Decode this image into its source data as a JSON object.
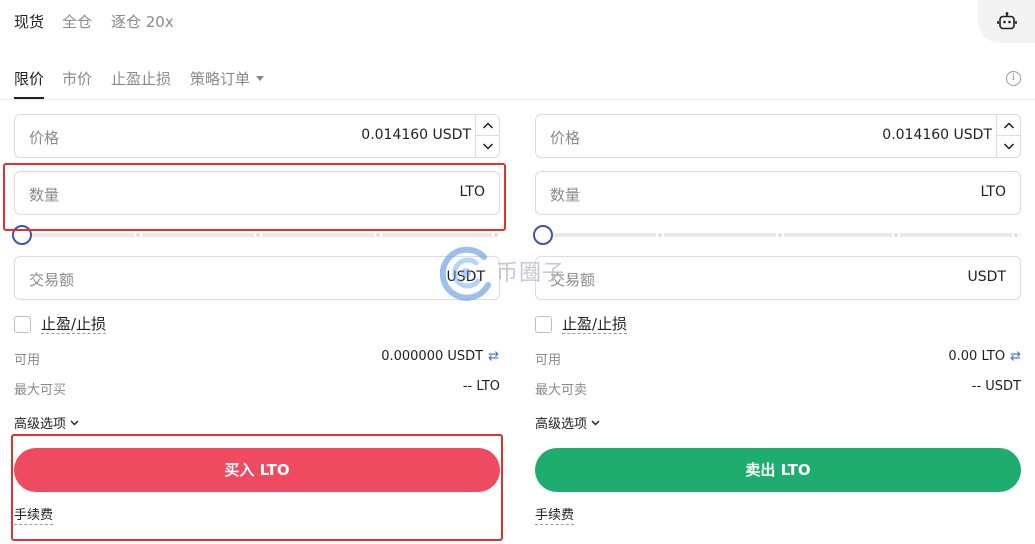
{
  "mode_tabs": {
    "spot": "现货",
    "cross": "全仓",
    "isolated": "逐仓 20x"
  },
  "order_tabs": {
    "limit": "限价",
    "market": "市价",
    "tp_sl": "止盈止损",
    "strategy": "策略订单"
  },
  "buy": {
    "price_label": "价格",
    "price_value": "0.014160 USDT",
    "amount_label": "数量",
    "amount_unit": "LTO",
    "total_label": "交易额",
    "total_unit": "USDT",
    "tpsl_label": "止盈/止损",
    "available_label": "可用",
    "available_value": "0.000000 USDT",
    "max_label": "最大可买",
    "max_value": "-- LTO",
    "advanced_label": "高级选项",
    "button_label": "买入 LTO",
    "fee_label": "手续费"
  },
  "sell": {
    "price_label": "价格",
    "price_value": "0.014160 USDT",
    "amount_label": "数量",
    "amount_unit": "LTO",
    "total_label": "交易额",
    "total_unit": "USDT",
    "tpsl_label": "止盈/止损",
    "available_label": "可用",
    "available_value": "0.00 LTO",
    "max_label": "最大可卖",
    "max_value": "-- USDT",
    "advanced_label": "高级选项",
    "button_label": "卖出 LTO",
    "fee_label": "手续费"
  },
  "slider": {
    "buy_percent": 0,
    "sell_percent": 0,
    "stops": [
      0,
      25,
      50,
      75,
      100
    ]
  },
  "watermark_text": "币圈子",
  "icons": {
    "robot": "robot-icon",
    "info": "info-icon",
    "swap": "swap-icon",
    "chevron": "chevron-down-icon",
    "arrow_up": "arrow-up-icon",
    "arrow_down": "arrow-down-icon"
  },
  "colors": {
    "buy": "#ef4b60",
    "sell": "#1fad6f",
    "slider_knob": "#3f51b5",
    "annotation": "#e0322b",
    "swap": "#3a6fd8"
  }
}
